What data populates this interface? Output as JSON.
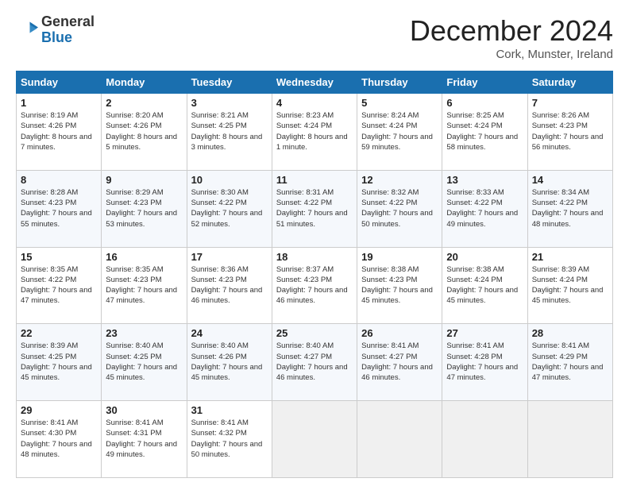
{
  "logo": {
    "general": "General",
    "blue": "Blue"
  },
  "title": "December 2024",
  "location": "Cork, Munster, Ireland",
  "days_header": [
    "Sunday",
    "Monday",
    "Tuesday",
    "Wednesday",
    "Thursday",
    "Friday",
    "Saturday"
  ],
  "weeks": [
    [
      {
        "num": "1",
        "sunrise": "8:19 AM",
        "sunset": "4:26 PM",
        "daylight": "8 hours and 7 minutes."
      },
      {
        "num": "2",
        "sunrise": "8:20 AM",
        "sunset": "4:26 PM",
        "daylight": "8 hours and 5 minutes."
      },
      {
        "num": "3",
        "sunrise": "8:21 AM",
        "sunset": "4:25 PM",
        "daylight": "8 hours and 3 minutes."
      },
      {
        "num": "4",
        "sunrise": "8:23 AM",
        "sunset": "4:24 PM",
        "daylight": "8 hours and 1 minute."
      },
      {
        "num": "5",
        "sunrise": "8:24 AM",
        "sunset": "4:24 PM",
        "daylight": "7 hours and 59 minutes."
      },
      {
        "num": "6",
        "sunrise": "8:25 AM",
        "sunset": "4:24 PM",
        "daylight": "7 hours and 58 minutes."
      },
      {
        "num": "7",
        "sunrise": "8:26 AM",
        "sunset": "4:23 PM",
        "daylight": "7 hours and 56 minutes."
      }
    ],
    [
      {
        "num": "8",
        "sunrise": "8:28 AM",
        "sunset": "4:23 PM",
        "daylight": "7 hours and 55 minutes."
      },
      {
        "num": "9",
        "sunrise": "8:29 AM",
        "sunset": "4:23 PM",
        "daylight": "7 hours and 53 minutes."
      },
      {
        "num": "10",
        "sunrise": "8:30 AM",
        "sunset": "4:22 PM",
        "daylight": "7 hours and 52 minutes."
      },
      {
        "num": "11",
        "sunrise": "8:31 AM",
        "sunset": "4:22 PM",
        "daylight": "7 hours and 51 minutes."
      },
      {
        "num": "12",
        "sunrise": "8:32 AM",
        "sunset": "4:22 PM",
        "daylight": "7 hours and 50 minutes."
      },
      {
        "num": "13",
        "sunrise": "8:33 AM",
        "sunset": "4:22 PM",
        "daylight": "7 hours and 49 minutes."
      },
      {
        "num": "14",
        "sunrise": "8:34 AM",
        "sunset": "4:22 PM",
        "daylight": "7 hours and 48 minutes."
      }
    ],
    [
      {
        "num": "15",
        "sunrise": "8:35 AM",
        "sunset": "4:22 PM",
        "daylight": "7 hours and 47 minutes."
      },
      {
        "num": "16",
        "sunrise": "8:35 AM",
        "sunset": "4:23 PM",
        "daylight": "7 hours and 47 minutes."
      },
      {
        "num": "17",
        "sunrise": "8:36 AM",
        "sunset": "4:23 PM",
        "daylight": "7 hours and 46 minutes."
      },
      {
        "num": "18",
        "sunrise": "8:37 AM",
        "sunset": "4:23 PM",
        "daylight": "7 hours and 46 minutes."
      },
      {
        "num": "19",
        "sunrise": "8:38 AM",
        "sunset": "4:23 PM",
        "daylight": "7 hours and 45 minutes."
      },
      {
        "num": "20",
        "sunrise": "8:38 AM",
        "sunset": "4:24 PM",
        "daylight": "7 hours and 45 minutes."
      },
      {
        "num": "21",
        "sunrise": "8:39 AM",
        "sunset": "4:24 PM",
        "daylight": "7 hours and 45 minutes."
      }
    ],
    [
      {
        "num": "22",
        "sunrise": "8:39 AM",
        "sunset": "4:25 PM",
        "daylight": "7 hours and 45 minutes."
      },
      {
        "num": "23",
        "sunrise": "8:40 AM",
        "sunset": "4:25 PM",
        "daylight": "7 hours and 45 minutes."
      },
      {
        "num": "24",
        "sunrise": "8:40 AM",
        "sunset": "4:26 PM",
        "daylight": "7 hours and 45 minutes."
      },
      {
        "num": "25",
        "sunrise": "8:40 AM",
        "sunset": "4:27 PM",
        "daylight": "7 hours and 46 minutes."
      },
      {
        "num": "26",
        "sunrise": "8:41 AM",
        "sunset": "4:27 PM",
        "daylight": "7 hours and 46 minutes."
      },
      {
        "num": "27",
        "sunrise": "8:41 AM",
        "sunset": "4:28 PM",
        "daylight": "7 hours and 47 minutes."
      },
      {
        "num": "28",
        "sunrise": "8:41 AM",
        "sunset": "4:29 PM",
        "daylight": "7 hours and 47 minutes."
      }
    ],
    [
      {
        "num": "29",
        "sunrise": "8:41 AM",
        "sunset": "4:30 PM",
        "daylight": "7 hours and 48 minutes."
      },
      {
        "num": "30",
        "sunrise": "8:41 AM",
        "sunset": "4:31 PM",
        "daylight": "7 hours and 49 minutes."
      },
      {
        "num": "31",
        "sunrise": "8:41 AM",
        "sunset": "4:32 PM",
        "daylight": "7 hours and 50 minutes."
      },
      null,
      null,
      null,
      null
    ]
  ],
  "labels": {
    "sunrise": "Sunrise:",
    "sunset": "Sunset:",
    "daylight": "Daylight:"
  }
}
